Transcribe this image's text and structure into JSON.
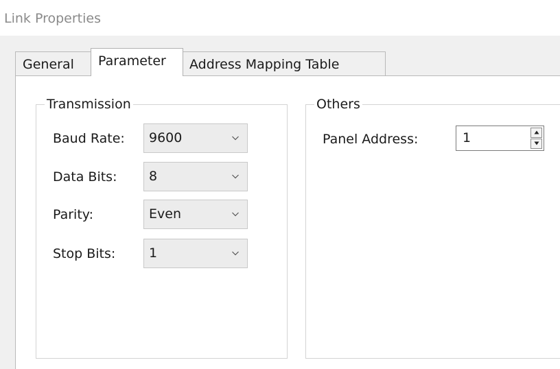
{
  "window": {
    "title": "Link Properties"
  },
  "tabs": [
    {
      "label": "General"
    },
    {
      "label": "Parameter"
    },
    {
      "label": "Address Mapping Table"
    }
  ],
  "active_tab": "Parameter",
  "transmission": {
    "legend": "Transmission",
    "baud_rate": {
      "label": "Baud Rate:",
      "value": "9600"
    },
    "data_bits": {
      "label": "Data Bits:",
      "value": "8"
    },
    "parity": {
      "label": "Parity:",
      "value": "Even"
    },
    "stop_bits": {
      "label": "Stop Bits:",
      "value": "1"
    }
  },
  "others": {
    "legend": "Others",
    "panel_address": {
      "label": "Panel Address:",
      "value": "1"
    }
  },
  "icons": {
    "combo_dropdown": "chevron-down-icon",
    "spin_up": "arrow-up-icon",
    "spin_down": "arrow-down-icon"
  },
  "colors": {
    "dialog_bg": "#f0f0f0",
    "panel_bg": "#ffffff",
    "combo_bg": "#ececec",
    "title_text": "#8a8a8a"
  }
}
